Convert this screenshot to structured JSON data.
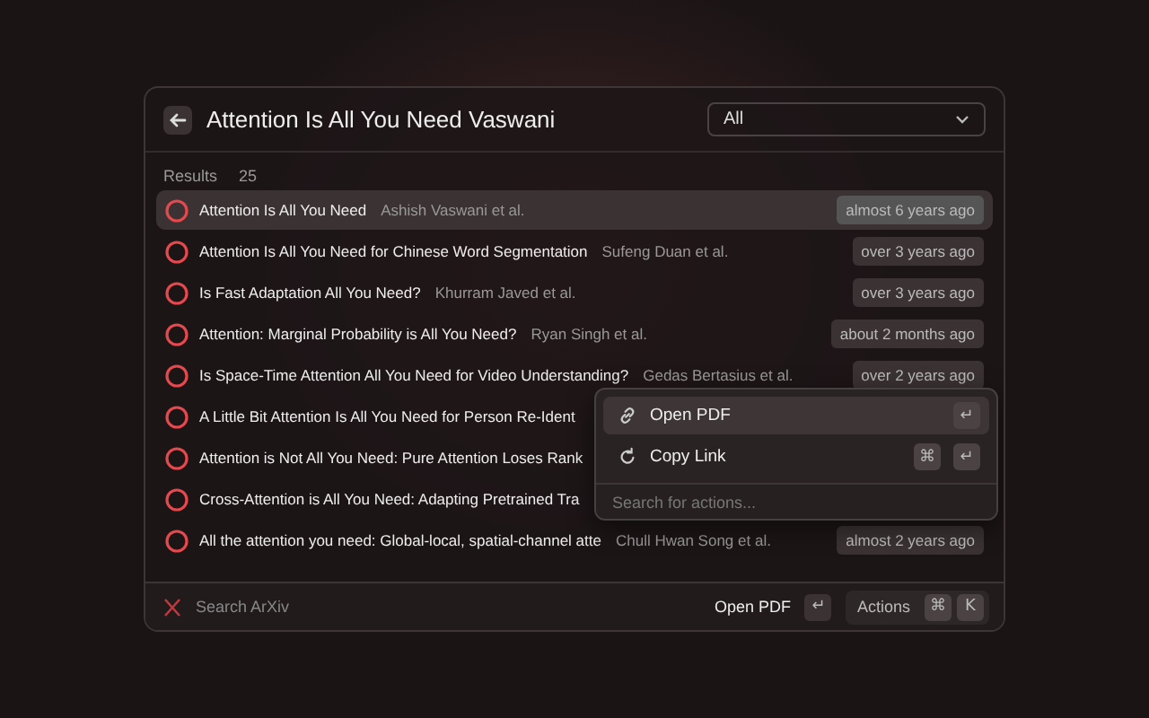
{
  "header": {
    "title": "Attention Is All You Need Vaswani",
    "filter": "All"
  },
  "results": {
    "label": "Results",
    "count": "25"
  },
  "rows": [
    {
      "title": "Attention Is All You Need",
      "authors": "Ashish Vaswani et al.",
      "date": "almost 6 years ago",
      "selected": true
    },
    {
      "title": "Attention Is All You Need for Chinese Word Segmentation",
      "authors": "Sufeng Duan et al.",
      "date": "over 3 years ago",
      "selected": false
    },
    {
      "title": "Is Fast Adaptation All You Need?",
      "authors": "Khurram Javed et al.",
      "date": "over 3 years ago",
      "selected": false
    },
    {
      "title": "Attention: Marginal Probability is All You Need?",
      "authors": "Ryan Singh et al.",
      "date": "about 2 months ago",
      "selected": false
    },
    {
      "title": "Is Space-Time Attention All You Need for Video Understanding?",
      "authors": "Gedas Bertasius et al.",
      "date": "over 2 years ago",
      "selected": false
    },
    {
      "title": "A Little Bit Attention Is All You Need for Person Re-Ident",
      "selected": false
    },
    {
      "title": "Attention is Not All You Need: Pure Attention Loses Rank",
      "selected": false
    },
    {
      "title": "Cross-Attention is All You Need: Adapting Pretrained Tra",
      "selected": false
    },
    {
      "title": "All the attention you need: Global-local, spatial-channel atte",
      "authors": "Chull Hwan Song et al.",
      "date": "almost 2 years ago",
      "selected": false
    }
  ],
  "actions_menu": {
    "items": [
      {
        "label": "Open PDF",
        "keys": [
          "↵"
        ],
        "selected": true
      },
      {
        "label": "Copy Link",
        "keys": [
          "⌘",
          "↵"
        ],
        "selected": false
      }
    ],
    "search": {
      "placeholder": "Search for actions..."
    }
  },
  "footer": {
    "source": "Search ArXiv",
    "primary_action": "Open PDF",
    "primary_key": "↵",
    "actions_label": "Actions",
    "actions_keys": [
      "⌘",
      "K"
    ]
  }
}
